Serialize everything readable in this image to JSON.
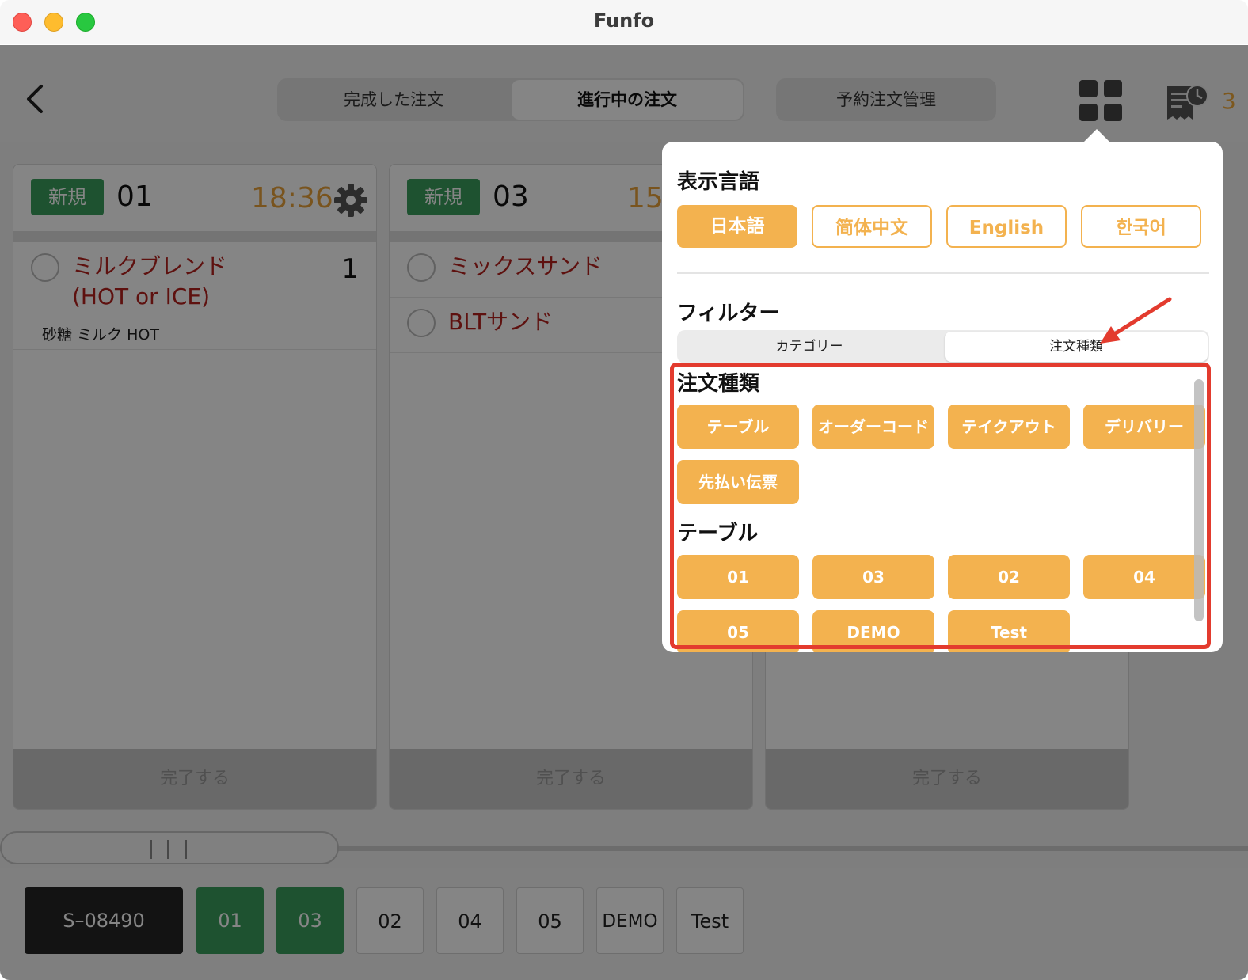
{
  "window": {
    "title": "Funfo"
  },
  "header": {
    "tabs": [
      "完成した注文",
      "進行中の注文"
    ],
    "reserve_label": "予約注文管理",
    "receipt_count": "3"
  },
  "orders": [
    {
      "badge": "新規",
      "table": "01",
      "time": "18:36",
      "items": [
        {
          "name_line1": "ミルクブレンド",
          "name_line2": "(HOT or ICE)",
          "qty": "1",
          "options": "砂糖 ミルク HOT"
        }
      ],
      "complete_label": "完了する"
    },
    {
      "badge": "新規",
      "table": "03",
      "time": "15",
      "items": [
        {
          "name": "ミックスサンド"
        },
        {
          "name": "BLTサンド"
        }
      ],
      "complete_label": "完了する"
    },
    {
      "complete_label": "完了する"
    }
  ],
  "table_bar": [
    "S–08490",
    "01",
    "03",
    "02",
    "04",
    "05",
    "DEMO",
    "Test"
  ],
  "popover": {
    "language_title": "表示言語",
    "languages": [
      "日本語",
      "简体中文",
      "English",
      "한국어"
    ],
    "filter_title": "フィルター",
    "filter_tabs": [
      "カテゴリー",
      "注文種類"
    ],
    "order_type_title": "注文種類",
    "order_types": [
      "テーブル",
      "オーダーコード",
      "テイクアウト",
      "デリバリー",
      "先払い伝票"
    ],
    "table_title": "テーブル",
    "tables": [
      "01",
      "03",
      "02",
      "04",
      "05",
      "DEMO",
      "Test"
    ]
  },
  "colors": {
    "accent_orange": "#f3b24f",
    "new_badge_green": "#3a9e5c",
    "item_red": "#b5221e",
    "annotation_red": "#e33b2e"
  }
}
